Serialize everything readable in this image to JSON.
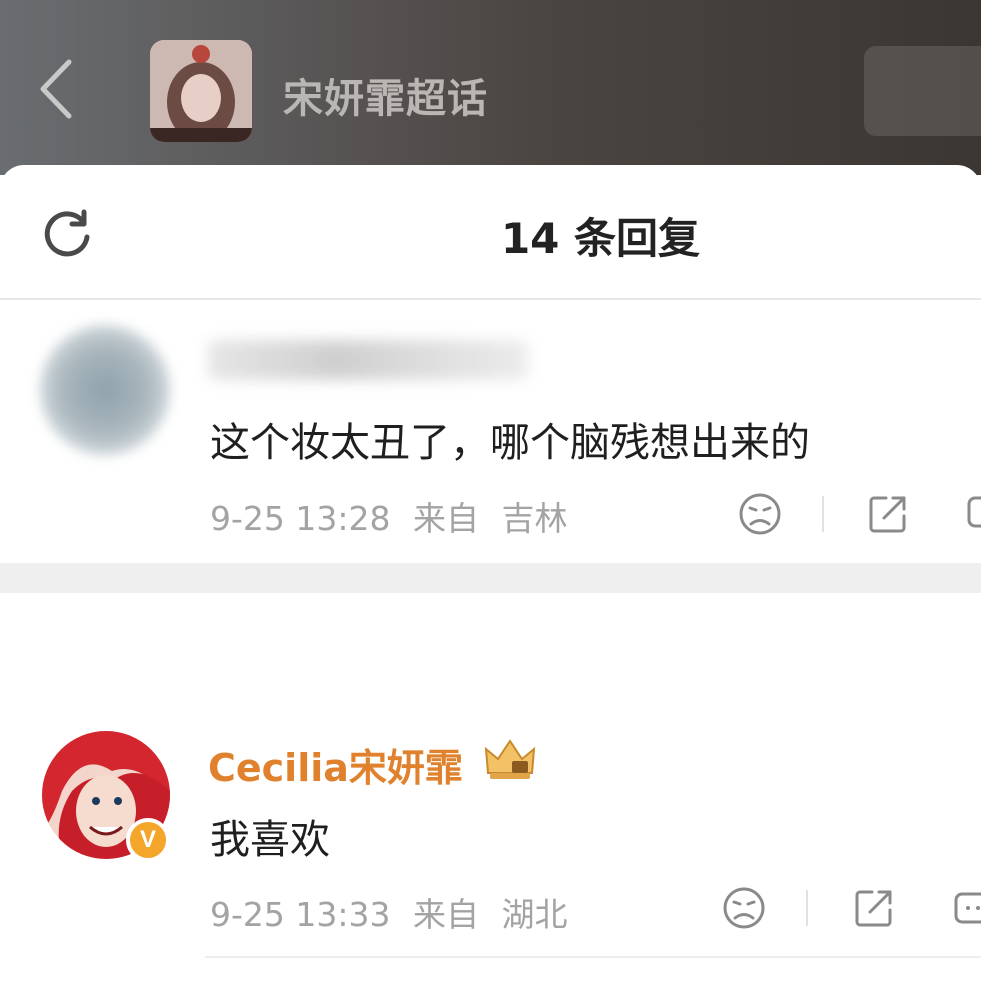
{
  "header": {
    "topic_title": "宋妍霏超话"
  },
  "sheet": {
    "reply_count": "14 条回复"
  },
  "comments": [
    {
      "text": "这个妆太丑了，哪个脑残想出来的",
      "date": "9-25 13:28",
      "from_label": "来自",
      "location": "吉林"
    },
    {
      "username": "Cecilia宋妍霏",
      "verified_badge": "V",
      "text": "我喜欢",
      "date": "9-25 13:33",
      "from_label": "来自",
      "location": "湖北"
    }
  ],
  "colors": {
    "username": "#e0822d",
    "verified": "#f4a62a",
    "meta": "#a3a3a3"
  },
  "icons": [
    "back-chevron-icon",
    "refresh-icon",
    "sad-face-icon",
    "share-icon",
    "comment-icon",
    "crown-icon",
    "verified-badge"
  ]
}
